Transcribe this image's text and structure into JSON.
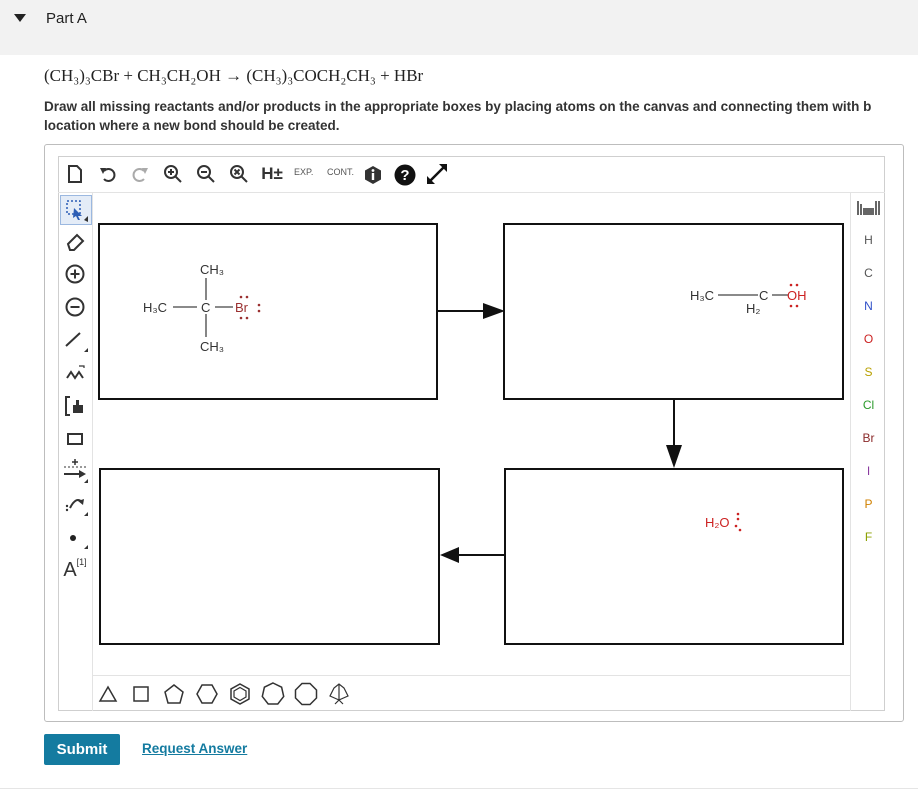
{
  "part": {
    "title": "Part A"
  },
  "question": {
    "equation": "(CH₃)₃CBr + CH₃CH₂OH → (CH₃)₃COCH₂CH₃ + HBr",
    "instructions_line1": "Draw all missing reactants and/or products in the appropriate boxes by placing atoms on the canvas and connecting them with b",
    "instructions_line2": "location where a new bond should be created."
  },
  "toolbar": {
    "hydrogen_label": "H±",
    "expand_label": "EXP.",
    "contract_label": "CONT.",
    "help_label": "?",
    "info_label": "i"
  },
  "left_toolbar": {
    "text_label": "A",
    "text_superscript": "[1]",
    "bracket_label": "[ ]"
  },
  "elements": [
    "H",
    "C",
    "N",
    "O",
    "S",
    "Cl",
    "Br",
    "I",
    "P",
    "F"
  ],
  "element_colors": {
    "H": "#555555",
    "C": "#555555",
    "N": "#3050c8",
    "O": "#cc2222",
    "S": "#b8a000",
    "Cl": "#2a9a2a",
    "Br": "#8b2a2a",
    "I": "#8a3aa0",
    "P": "#d08000",
    "F": "#8ca000"
  },
  "canvas": {
    "molecule1": {
      "top_group": "CH₃",
      "left_group": "H₃C",
      "center": "C",
      "halogen": "Br",
      "bottom_group": "CH₃"
    },
    "molecule2": {
      "left_group": "H₃C",
      "center": "C",
      "center_h": "H₂",
      "hydroxyl": "OH"
    },
    "molecule3": {
      "formula": "H₂O"
    }
  },
  "actions": {
    "submit_label": "Submit",
    "request_answer_label": "Request Answer"
  }
}
